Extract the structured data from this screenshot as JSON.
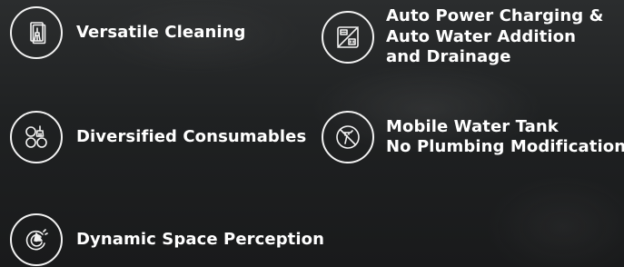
{
  "features": [
    {
      "lines": [
        "Versatile Cleaning"
      ],
      "icon": "cleaning-tool-icon"
    },
    {
      "lines": [
        "Auto Power Charging &",
        "Auto Water Addition",
        "and Drainage"
      ],
      "icon": "charging-station-icon"
    },
    {
      "lines": [
        "Diversified Consumables"
      ],
      "icon": "consumables-icon"
    },
    {
      "lines": [
        "Mobile Water Tank",
        "No Plumbing Modification"
      ],
      "icon": "no-plumbing-icon"
    },
    {
      "lines": [
        "Dynamic Space Perception"
      ],
      "icon": "space-perception-icon"
    }
  ],
  "colors": {
    "text": "#ffffff",
    "icon_stroke": "#f2f2f2",
    "background": "#1f2122"
  }
}
